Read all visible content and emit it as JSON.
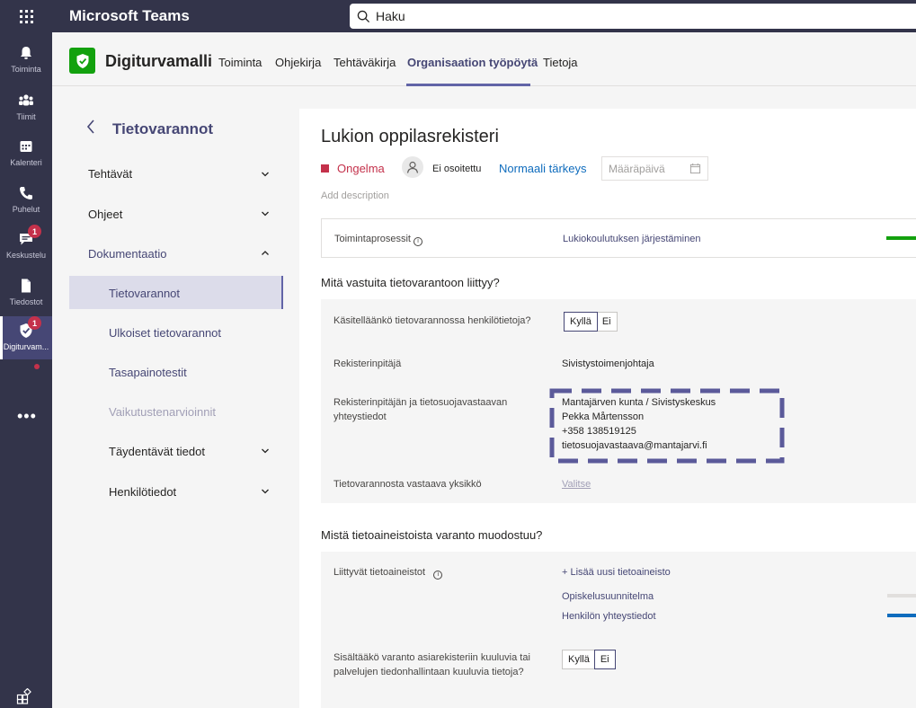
{
  "topbar": {
    "app_title": "Microsoft Teams",
    "search_placeholder": "Haku"
  },
  "rail": {
    "items": [
      {
        "label": "Toiminta",
        "icon": "bell-icon"
      },
      {
        "label": "Tiimit",
        "icon": "teams-icon"
      },
      {
        "label": "Kalenteri",
        "icon": "calendar-icon"
      },
      {
        "label": "Puhelut",
        "icon": "phone-icon"
      },
      {
        "label": "Keskustelu",
        "icon": "chat-icon",
        "badge": "1"
      },
      {
        "label": "Tiedostot",
        "icon": "files-icon"
      },
      {
        "label": "Digiturvam...",
        "icon": "shield-check-icon",
        "badge": "1"
      }
    ],
    "more_label": "•••",
    "apps_icon": "apps-icon"
  },
  "header": {
    "app_name": "Digiturvamalli",
    "tabs": [
      {
        "label": "Toiminta"
      },
      {
        "label": "Ohjekirja"
      },
      {
        "label": "Tehtäväkirja"
      },
      {
        "label": "Organisaation työpöytä",
        "active": true
      },
      {
        "label": "Tietoja"
      }
    ]
  },
  "sidebar": {
    "title": "Tietovarannot",
    "sections": [
      {
        "label": "Tehtävät"
      },
      {
        "label": "Ohjeet"
      },
      {
        "label": "Dokumentaatio"
      }
    ],
    "subitems": [
      {
        "label": "Tietovarannot",
        "selected": true
      },
      {
        "label": "Ulkoiset tietovarannot"
      },
      {
        "label": "Tasapainotestit"
      },
      {
        "label": "Vaikutustenarvioinnit",
        "disabled": true
      },
      {
        "label": "Täydentävät tiedot"
      },
      {
        "label": "Henkilötiedot"
      }
    ]
  },
  "main": {
    "title": "Lukion oppilasrekisteri",
    "status": "Ongelma",
    "assignee": "Ei osoitettu",
    "priority": "Normaali tärkeys",
    "due_date_placeholder": "Määräpäivä",
    "add_description": "Add description",
    "process_label": "Toimintaprosessit",
    "process_value": "Lukiokoulutuksen järjestäminen",
    "section1_title": "Mitä vastuita tietovarantoon liittyy?",
    "q_personal_data": "Käsitelläänkö tietovarannossa henkilötietoja?",
    "yes": "Kyllä",
    "no": "Ei",
    "controller_label": "Rekisterinpitäjä",
    "controller_value": "Sivistystoimenjohtaja",
    "contact_label_1": "Rekisterinpitäjän ja tietosuojavastaavan",
    "contact_label_2": "yhteystiedot",
    "contact_lines": [
      "Mantajärven kunta / Sivistyskeskus",
      "Pekka Mårtensson",
      "+358 138519125",
      "tietosuojavastaava@mantajarvi.fi"
    ],
    "unit_label": "Tietovarannosta vastaava yksikkö",
    "unit_value": "Valitse",
    "section2_title": "Mistä tietoaineistoista varanto muodostuu?",
    "datasets_label": "Liittyvät tietoaineistot",
    "add_dataset": "+ Lisää uusi tietoaineisto",
    "datasets": [
      "Opiskelusuunnitelma",
      "Henkilön yhteystiedot"
    ],
    "q_records_1": "Sisältääkö varanto asiarekisteriin kuuluvia tai",
    "q_records_2": "palvelujen tiedonhallintaan kuuluvia tietoja?"
  },
  "colors": {
    "brand": "#464775",
    "accent": "#6264a7",
    "status_red": "#c4314b",
    "progress_green": "#13a10e",
    "progress_blue": "#0f6cbd"
  }
}
